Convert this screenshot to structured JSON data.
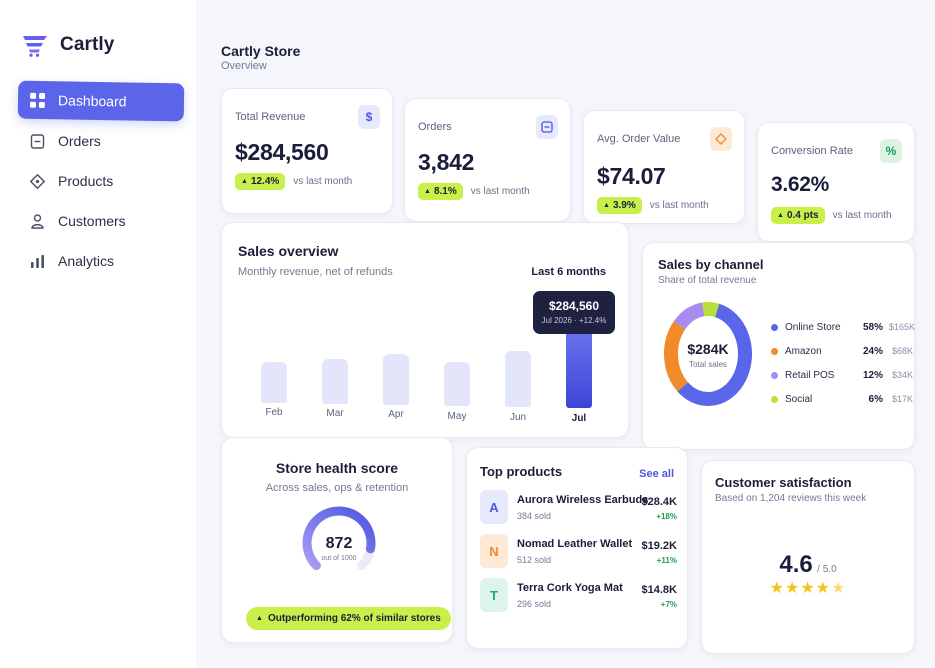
{
  "app": {
    "name": "Cartly"
  },
  "nav": [
    {
      "label": "Dashboard",
      "icon": "grid-icon",
      "active": true
    },
    {
      "label": "Orders",
      "icon": "receipt-icon",
      "active": false
    },
    {
      "label": "Products",
      "icon": "tag-icon",
      "active": false
    },
    {
      "label": "Customers",
      "icon": "user-icon",
      "active": false
    },
    {
      "label": "Analytics",
      "icon": "bar-chart-icon",
      "active": false
    }
  ],
  "header": {
    "title": "Cartly Store",
    "subtitle": "Overview"
  },
  "kpis": [
    {
      "label": "Total Revenue",
      "value": "$284,560",
      "change": "12.4%",
      "vs": "vs last month",
      "icon_glyph": "$",
      "icon": "dollar-icon",
      "icon_bg": "#e7e9fd",
      "icon_color": "#4c56e0"
    },
    {
      "label": "Orders",
      "value": "3,842",
      "change": "8.1%",
      "vs": "vs last month",
      "icon_glyph": "",
      "icon": "receipt-icon",
      "icon_bg": "#e7e9fd",
      "icon_color": "#4c56e0"
    },
    {
      "label": "Avg. Order Value",
      "value": "$74.07",
      "change": "3.9%",
      "vs": "vs last month",
      "icon_glyph": "",
      "icon": "diamond-icon",
      "icon_bg": "#fde9d6",
      "icon_color": "#f08a2a"
    },
    {
      "label": "Conversion Rate",
      "value": "3.62%",
      "change": "0.4 pts",
      "vs": "vs last month",
      "icon_glyph": "%",
      "icon": "percent-icon",
      "icon_bg": "#ddf4e4",
      "icon_color": "#1e9a52"
    }
  ],
  "sales_overview": {
    "title": "Sales overview",
    "subtitle": "Monthly revenue, net of refunds",
    "range": "Last 6 months",
    "tooltip": {
      "value": "$284,560",
      "detail": "Jul 2026 · +12.4%"
    }
  },
  "chart_data": {
    "type": "bar",
    "categories": [
      "Feb",
      "Mar",
      "Apr",
      "May",
      "Jun",
      "Jul"
    ],
    "values": [
      205,
      212,
      225,
      210,
      235,
      284.56
    ],
    "highlight": "Jul",
    "colors": {
      "bar": "#e3e6fa",
      "highlight": "#4a52e0"
    }
  },
  "channels": {
    "title": "Sales by channel",
    "subtitle": "Share of total revenue",
    "total": "$284K",
    "total_label": "Total sales",
    "items": [
      {
        "name": "Online Store",
        "pct": "58%",
        "amount": "$165K",
        "share": 58,
        "color": "#5a65ea"
      },
      {
        "name": "Amazon",
        "pct": "24%",
        "amount": "$68K",
        "share": 24,
        "color": "#f08a2a"
      },
      {
        "name": "Retail POS",
        "pct": "12%",
        "amount": "$34K",
        "share": 12,
        "color": "#a78bf0"
      },
      {
        "name": "Social",
        "pct": "6%",
        "amount": "$17K",
        "share": 6,
        "color": "#b8de3a"
      }
    ]
  },
  "health": {
    "title": "Store health score",
    "subtitle": "Across sales, ops & retention",
    "score": "872",
    "score_max_label": "out of 1000",
    "score_fraction": 0.872,
    "badge": "Outperforming 62% of similar stores"
  },
  "top_products": {
    "title": "Top products",
    "see_all": "See all",
    "items": [
      {
        "initial": "A",
        "name": "Aurora Wireless Earbuds",
        "sold": "384 sold",
        "price": "$28.4K",
        "change": "+18%",
        "bg": "#e7e9fd",
        "fg": "#4c56e0"
      },
      {
        "initial": "N",
        "name": "Nomad Leather Wallet",
        "sold": "512 sold",
        "price": "$19.2K",
        "change": "+11%",
        "bg": "#fde9d6",
        "fg": "#f08a2a"
      },
      {
        "initial": "T",
        "name": "Terra Cork Yoga Mat",
        "sold": "296 sold",
        "price": "$14.8K",
        "change": "+7%",
        "bg": "#ddf4ea",
        "fg": "#1ea38a"
      }
    ]
  },
  "satisfaction": {
    "title": "Customer satisfaction",
    "subtitle": "Based on 1,204 reviews this week",
    "score": "4.6",
    "out_of": "/ 5.0",
    "rating": 4.6
  }
}
